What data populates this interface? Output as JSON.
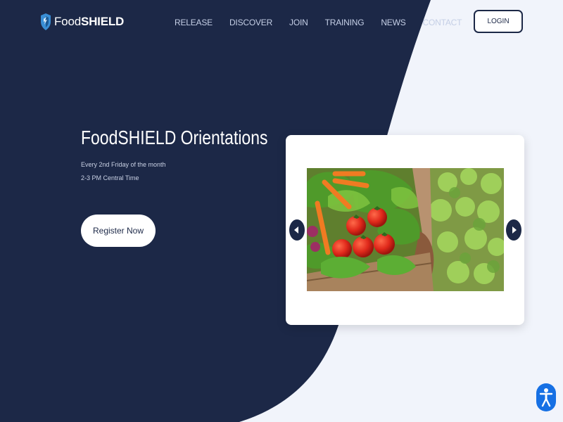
{
  "brand": {
    "name_light": "Food",
    "name_bold": "SHIELD",
    "logo_icon": "shield-icon"
  },
  "nav": {
    "items": [
      {
        "label": "RELEASE"
      },
      {
        "label": "DISCOVER"
      },
      {
        "label": "JOIN"
      },
      {
        "label": "TRAINING"
      },
      {
        "label": "NEWS"
      },
      {
        "label": "CONTACT"
      }
    ],
    "login_label": "LOGIN"
  },
  "hero": {
    "title": "FoodSHIELD Orientations",
    "line1": "Every 2nd Friday of the month",
    "line2": "2-3 PM Central Time",
    "cta_label": "Register Now"
  },
  "carousel": {
    "image_alt_icon": "vegetable-crate-photo",
    "prev_icon": "chevron-left-icon",
    "next_icon": "chevron-right-icon"
  },
  "accessibility": {
    "icon": "accessibility-icon"
  },
  "colors": {
    "navy": "#1c2847",
    "light_bg": "#f1f4fb",
    "accent_blue": "#1670e4",
    "logo_blue": "#3a8fd6"
  }
}
